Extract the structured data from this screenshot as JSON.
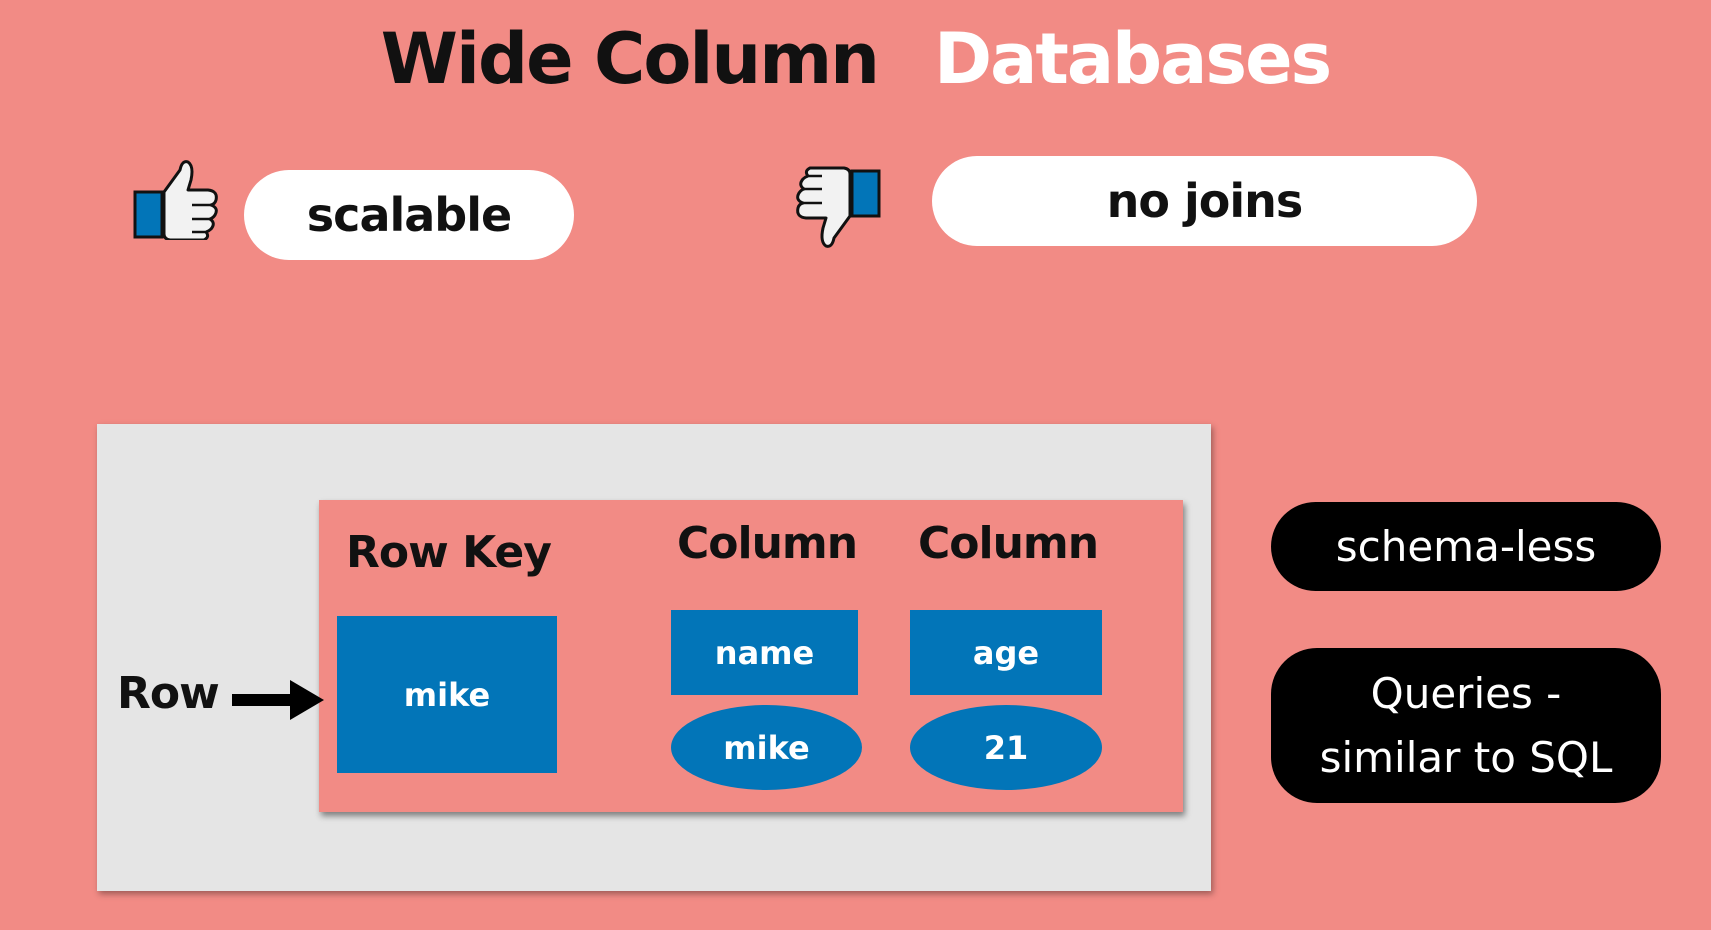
{
  "title": {
    "part1": "Wide Column",
    "part2": "Databases"
  },
  "pros": {
    "icon": "thumbs-up-icon",
    "label": "scalable"
  },
  "cons": {
    "icon": "thumbs-down-icon",
    "label": "no joins"
  },
  "diagram": {
    "row_label": "Row",
    "row_key_header": "Row Key",
    "row_key_value": "mike",
    "columns": [
      {
        "header": "Column",
        "name": "name",
        "value": "mike"
      },
      {
        "header": "Column",
        "name": "age",
        "value": "21"
      }
    ]
  },
  "features": [
    {
      "line1": "schema-less",
      "line2": ""
    },
    {
      "line1": "Queries -",
      "line2": "similar to SQL"
    }
  ],
  "colors": {
    "background": "#f28b85",
    "cell_blue": "#0275b8",
    "panel_gray": "#e5e5e5",
    "title_white": "#ffffff"
  }
}
